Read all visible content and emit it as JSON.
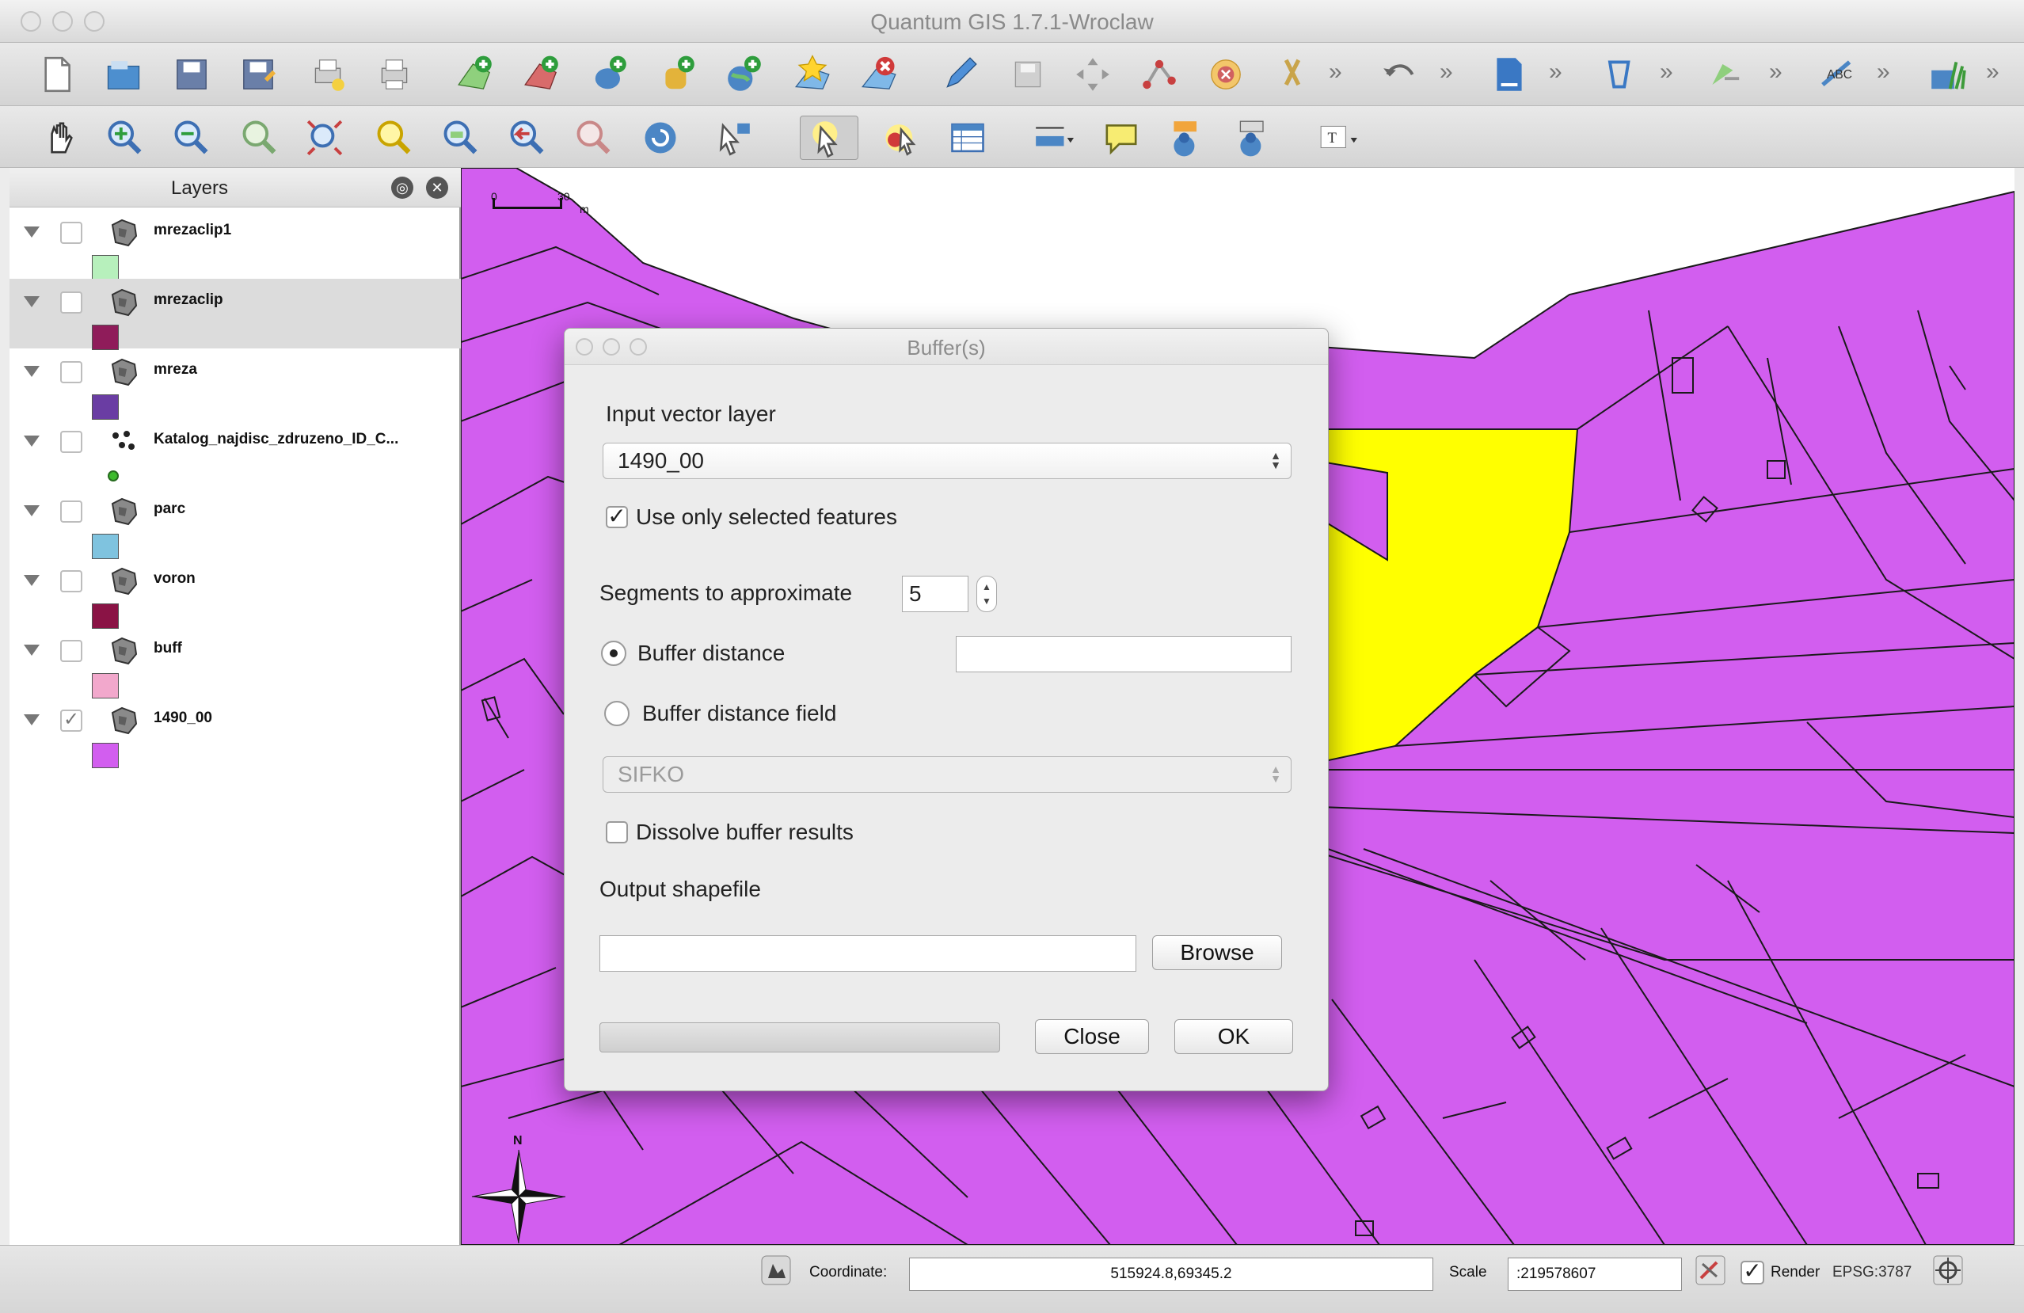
{
  "window": {
    "title": "Quantum GIS 1.7.1-Wroclaw"
  },
  "layers_panel": {
    "title": "Layers",
    "items": [
      {
        "name": "mrezaclip1",
        "checked": false,
        "selected": false,
        "symbol": "polygon",
        "swatch_color": "#b7f0bc"
      },
      {
        "name": "mrezaclip",
        "checked": false,
        "selected": true,
        "symbol": "polygon",
        "swatch_color": "#8f1c5a"
      },
      {
        "name": "mreza",
        "checked": false,
        "selected": false,
        "symbol": "polygon",
        "swatch_color": "#6a3da3"
      },
      {
        "name": "Katalog_najdisc_zdruzeno_ID_C...",
        "checked": false,
        "selected": false,
        "symbol": "point",
        "swatch_color": "#3dbb2d"
      },
      {
        "name": "parc",
        "checked": false,
        "selected": false,
        "symbol": "polygon",
        "swatch_color": "#7fc3df"
      },
      {
        "name": "voron",
        "checked": false,
        "selected": false,
        "symbol": "polygon",
        "swatch_color": "#8a1345"
      },
      {
        "name": "buff",
        "checked": false,
        "selected": false,
        "symbol": "polygon",
        "swatch_color": "#f2a8cc"
      },
      {
        "name": "1490_00",
        "checked": true,
        "selected": false,
        "symbol": "polygon",
        "swatch_color": "#d25eef"
      }
    ]
  },
  "map": {
    "scalebar": {
      "start": "0",
      "end": "30",
      "unit": "m"
    },
    "north_label": "N",
    "colors": {
      "parcel_fill": "#d25eef",
      "selected_fill": "#ffff00",
      "line": "#1a1a1a"
    }
  },
  "dialog": {
    "title": "Buffer(s)",
    "input_layer_label": "Input vector layer",
    "input_layer_value": "1490_00",
    "only_selected_label": "Use only selected features",
    "only_selected_checked": true,
    "segments_label": "Segments to approximate",
    "segments_value": "5",
    "buffer_distance_label": "Buffer distance",
    "buffer_distance_value": "",
    "buffer_distance_field_label": "Buffer distance field",
    "distance_field_value": "SIFKO",
    "dissolve_label": "Dissolve buffer results",
    "dissolve_checked": false,
    "output_label": "Output shapefile",
    "output_value": "",
    "browse_label": "Browse",
    "close_label": "Close",
    "ok_label": "OK"
  },
  "statusbar": {
    "coordinate_label": "Coordinate:",
    "coordinate_value": "515924.8,69345.2",
    "scale_label": "Scale",
    "scale_value": ":219578607",
    "render_label": "Render",
    "render_checked": true,
    "crs_label": "EPSG:3787"
  },
  "check_mark": "✓"
}
